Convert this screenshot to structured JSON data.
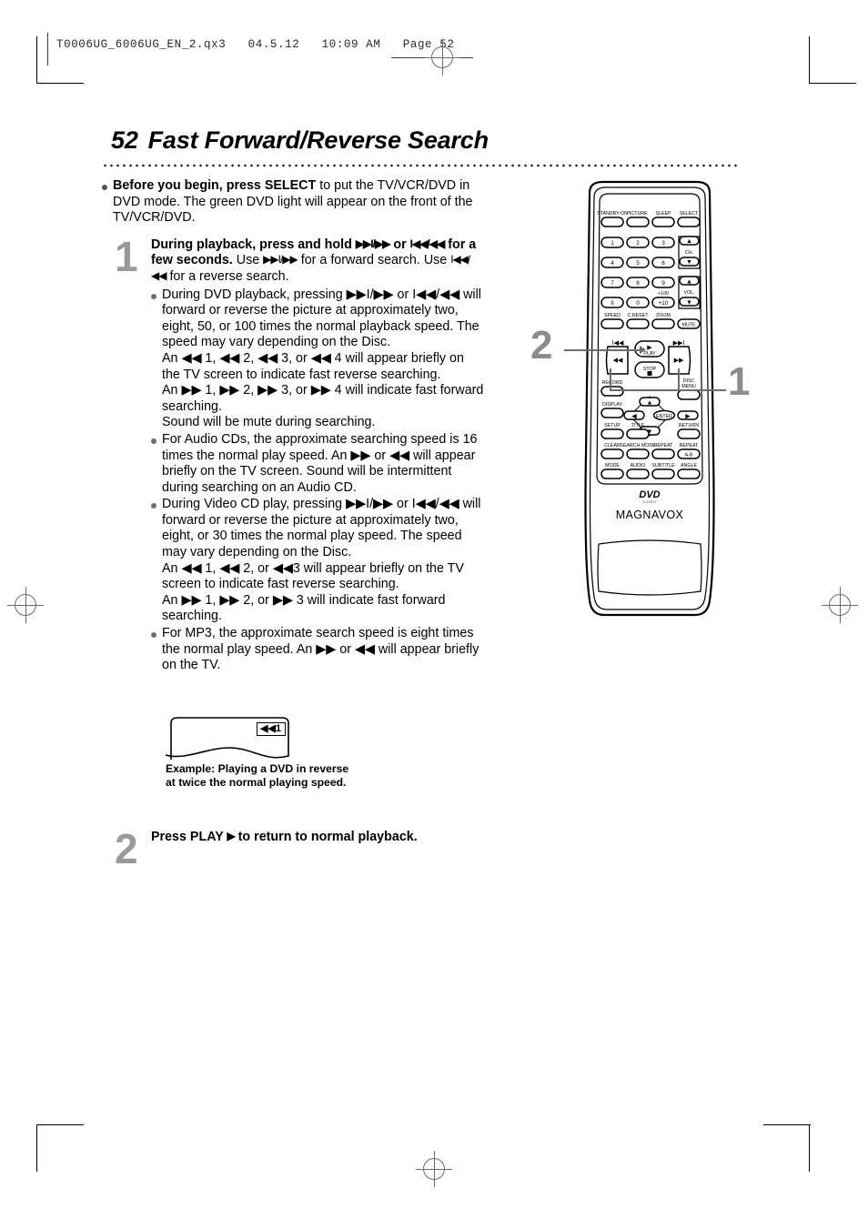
{
  "page": {
    "file_header": "T0006UG_6006UG_EN_2.qx3   04.5.12   10:09 AM   Page 52",
    "page_number": "52",
    "title": "Fast Forward/Reverse Search"
  },
  "intro": {
    "bold_lead": "Before you begin, press SELECT",
    "rest": " to put the TV/VCR/DVD in DVD mode.  The green DVD light will appear on the front of the TV/VCR/DVD."
  },
  "steps": [
    {
      "number": "1",
      "heading_parts": {
        "bold_a": "During playback, press and hold ",
        "sym_ff1": "▶▶I/▶▶",
        "bold_b": " or ",
        "sym_rew1": "I◀◀/◀◀",
        "bold_c": " for a few seconds.",
        "plain_a": " Use ",
        "sym_ff2": "▶▶I/▶▶",
        "plain_b": " for a forward search.  Use ",
        "sym_rew2": "I◀◀/◀◀",
        "plain_c": " for a reverse search."
      },
      "bullets": [
        {
          "lines": [
            "During DVD playback, pressing ▶▶I/▶▶ or I◀◀/◀◀ will forward or reverse the picture at approximately two, eight, 50, or 100 times the normal playback speed.  The speed may vary depending on the Disc.",
            "An ◀◀ 1, ◀◀ 2, ◀◀ 3, or ◀◀ 4 will appear briefly on the TV screen to indicate fast reverse searching.",
            "An ▶▶ 1, ▶▶ 2, ▶▶ 3, or ▶▶ 4 will indicate fast forward searching.",
            "Sound will be mute during searching."
          ]
        },
        {
          "lines": [
            " For Audio CDs, the approximate searching speed is 16 times the normal play speed.  An ▶▶ or ◀◀ will appear briefly on the TV screen.  Sound will be intermittent during searching on an Audio CD."
          ]
        },
        {
          "lines": [
            "During Video CD play, pressing ▶▶I/▶▶ or I◀◀/◀◀ will forward or reverse the picture at approximately two, eight, or 30 times the normal play speed. The speed may vary depending on the Disc.",
            "An ◀◀ 1, ◀◀ 2, or ◀◀3 will appear briefly on the TV screen to indicate fast reverse searching.",
            "An ▶▶ 1, ▶▶ 2, or ▶▶ 3 will indicate fast forward searching."
          ]
        },
        {
          "lines": [
            "For MP3, the approximate search speed is eight times the normal play speed. An ▶▶ or ◀◀ will appear briefly on the TV."
          ]
        }
      ]
    },
    {
      "number": "2",
      "heading_parts": {
        "bold_a": "Press PLAY ",
        "sym_ff1": "▶",
        "bold_b": " to return to normal playback.",
        "sym_rew1": "",
        "bold_c": "",
        "plain_a": "",
        "sym_ff2": "",
        "plain_b": "",
        "sym_rew2": "",
        "plain_c": ""
      },
      "bullets": []
    }
  ],
  "tv_example": {
    "osd_text": "◀◀1",
    "caption": "Example: Playing a DVD in reverse at twice the normal playing speed."
  },
  "remote": {
    "brand": "MAGNAVOX",
    "logo": "DVD",
    "logo_sub": "VIDEO",
    "row_top": [
      "STANDBY-ON",
      "PICTURE",
      "SLEEP",
      "SELECT"
    ],
    "keypad": [
      [
        "1",
        "2",
        "3"
      ],
      [
        "4",
        "5",
        "6"
      ],
      [
        "7",
        "8",
        "9"
      ],
      [
        "II",
        "0",
        "+10"
      ]
    ],
    "plus100_label": "+100",
    "ch_label": "CH.",
    "vol_label": "VOL.",
    "row_speed": [
      "SPEED",
      "C.RESET",
      "ZOOM"
    ],
    "mute_label": "MUTE",
    "transport": {
      "skip_back": "I◀◀",
      "play": "PLAY",
      "skip_fwd": "▶▶I",
      "rew": "◀◀",
      "stop": "STOP",
      "ff": "▶▶"
    },
    "record_label": "RECORD",
    "disc_menu_label": "DISC MENU",
    "display_label": "DISPLAY",
    "enter_label": "ENTER",
    "setup_label": "SETUP",
    "title_label": "TITLE",
    "return_label": "RETURN",
    "row_clear": [
      "CLEAR",
      "SEARCH MODE",
      "REPEAT",
      "REPEAT"
    ],
    "repeat_ab_label": "A-B",
    "row_mode": [
      "MODE",
      "AUDIO",
      "SUBTITLE",
      "ANGLE"
    ]
  },
  "callouts": [
    {
      "number": "2",
      "target": "play-button"
    },
    {
      "number": "1",
      "target": "search-buttons"
    }
  ],
  "colors": {
    "step_number": "#9a9a9a",
    "bullet_dot": "#6e6e6e",
    "callout_line": "#6e6e6e",
    "text": "#000000"
  }
}
